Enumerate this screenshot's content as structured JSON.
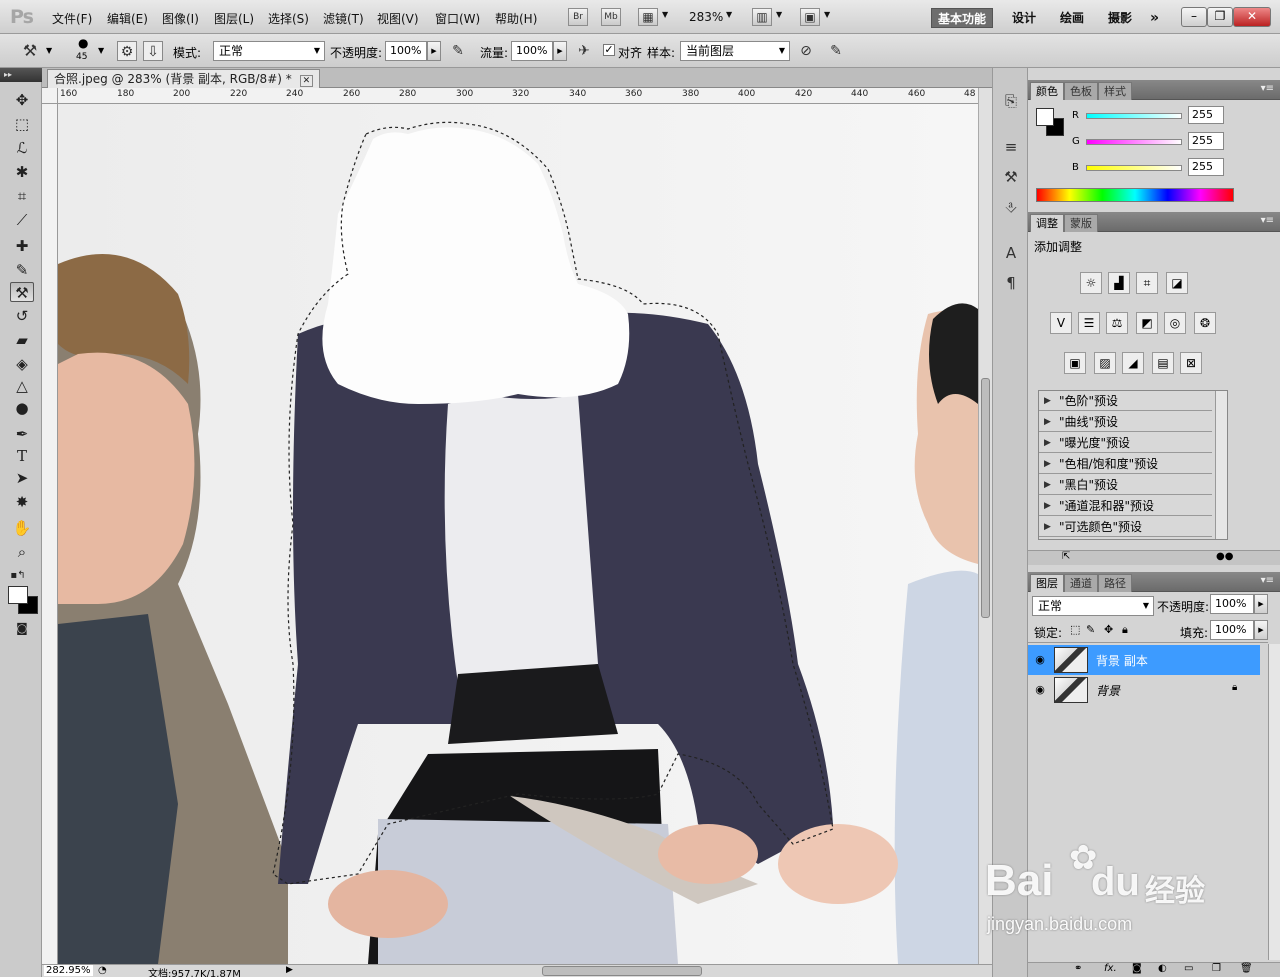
{
  "app": {
    "logo": "Ps"
  },
  "menu": [
    "文件(F)",
    "编辑(E)",
    "图像(I)",
    "图层(L)",
    "选择(S)",
    "滤镜(T)",
    "视图(V)",
    "窗口(W)",
    "帮助(H)"
  ],
  "titlebar": {
    "br": "Br",
    "mb": "Mb",
    "zoom": "283%"
  },
  "workspaces": [
    "基本功能",
    "设计",
    "绘画",
    "摄影"
  ],
  "options": {
    "brush_size": "45",
    "mode_label": "模式:",
    "mode_value": "正常",
    "opacity_label": "不透明度:",
    "opacity_value": "100%",
    "flow_label": "流量:",
    "flow_value": "100%",
    "aligned_label": "对齐",
    "sample_label": "样本:",
    "sample_value": "当前图层"
  },
  "document": {
    "tab_title": "合照.jpeg @ 283% (背景 副本, RGB/8#) *",
    "ruler_marks": [
      "160",
      "180",
      "200",
      "220",
      "240",
      "260",
      "280",
      "300",
      "320",
      "340",
      "360",
      "380",
      "400",
      "420",
      "440",
      "460",
      "48"
    ],
    "status_zoom": "282.95%",
    "status_doc": "文档:957.7K/1.87M"
  },
  "color_panel": {
    "tabs": [
      "颜色",
      "色板",
      "样式"
    ],
    "r_label": "R",
    "r_value": "255",
    "g_label": "G",
    "g_value": "255",
    "b_label": "B",
    "b_value": "255"
  },
  "adjust_panel": {
    "tabs": [
      "调整",
      "蒙版"
    ],
    "title": "添加调整",
    "presets": [
      "\"色阶\"预设",
      "\"曲线\"预设",
      "\"曝光度\"预设",
      "\"色相/饱和度\"预设",
      "\"黑白\"预设",
      "\"通道混和器\"预设",
      "\"可选颜色\"预设"
    ]
  },
  "layers_panel": {
    "tabs": [
      "图层",
      "通道",
      "路径"
    ],
    "blend_value": "正常",
    "opacity_label": "不透明度:",
    "opacity_value": "100%",
    "lock_label": "锁定:",
    "fill_label": "填充:",
    "fill_value": "100%",
    "layers": [
      {
        "name": "背景 副本",
        "selected": true
      },
      {
        "name": "背景",
        "selected": false
      }
    ]
  },
  "watermark": {
    "brand": "Bai",
    "brand2": "du",
    "cn": "经验",
    "url": "jingyan.baidu.com"
  },
  "colors": {
    "selection": "#3d9bff",
    "accent_bg": "#6e6e6e"
  }
}
